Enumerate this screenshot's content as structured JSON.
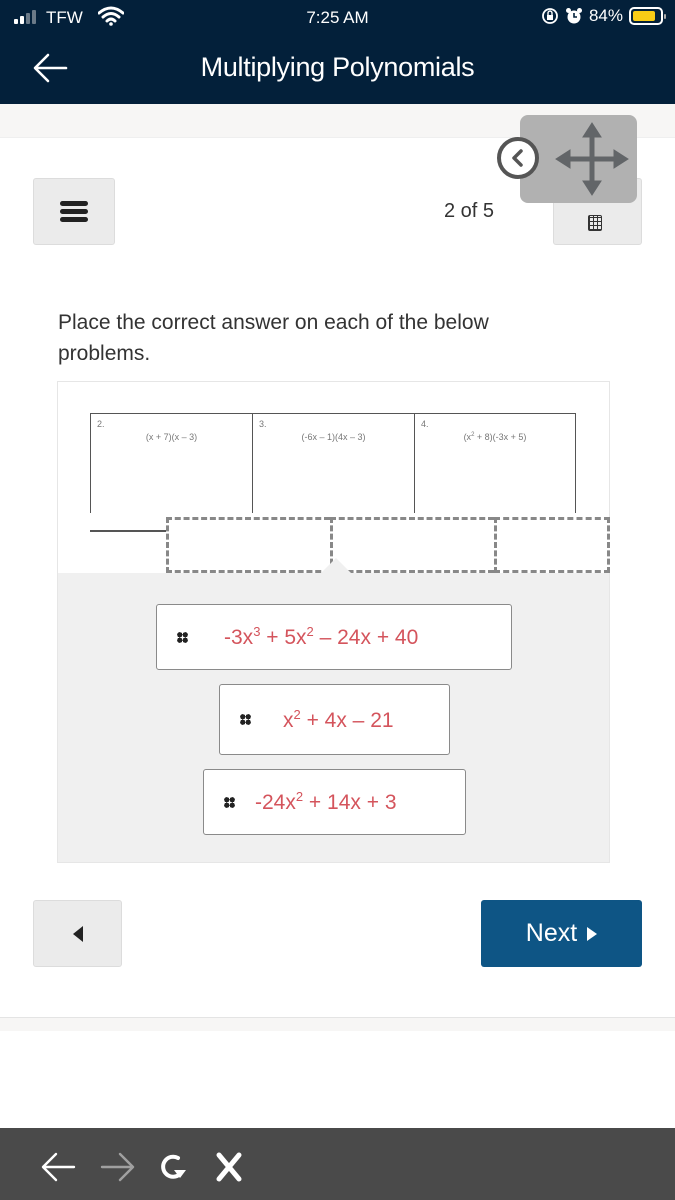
{
  "status_bar": {
    "carrier": "TFW",
    "time": "7:25 AM",
    "battery_percent": "84%",
    "battery_level": 0.84,
    "icons": [
      "signal-icon",
      "wifi-icon",
      "orientation-lock-icon",
      "alarm-icon",
      "battery-icon"
    ]
  },
  "header": {
    "title": "Multiplying Polynomials",
    "back_icon": "back-arrow-icon"
  },
  "toolbar": {
    "menu_icon": "hamburger-menu-icon",
    "page_indicator": "2 of 5",
    "calculator_icon": "calculator-icon",
    "move_icon": "move-arrows-icon",
    "collapse_icon": "chevron-left-circle-icon"
  },
  "instructions": "Place the correct answer on each of the below problems.",
  "problems": [
    {
      "number": "2.",
      "expression": "(x + 7)(x – 3)"
    },
    {
      "number": "3.",
      "expression": "(-6x – 1)(4x – 3)"
    },
    {
      "number": "4.",
      "expression_parts": [
        "(x",
        "2",
        " + 8)(-3x + 5)"
      ]
    }
  ],
  "answer_bank": [
    {
      "parts": [
        "-3x",
        "3",
        " + 5x",
        "2",
        " –  24x + 40"
      ]
    },
    {
      "parts": [
        "x",
        "2",
        " + 4x – 21"
      ]
    },
    {
      "parts": [
        "-24x",
        "2",
        " + 14x + 3"
      ]
    }
  ],
  "navigation": {
    "prev_icon": "triangle-left-icon",
    "next_label": "Next",
    "next_icon": "triangle-right-icon",
    "next_color": "#0e5585"
  },
  "browser_toolbar": {
    "icons": [
      "back-icon",
      "forward-icon",
      "reload-icon",
      "close-icon"
    ]
  },
  "colors": {
    "header_bg": "#03203a",
    "answer_text": "#d4545c",
    "battery_fill": "#f7cc16"
  }
}
